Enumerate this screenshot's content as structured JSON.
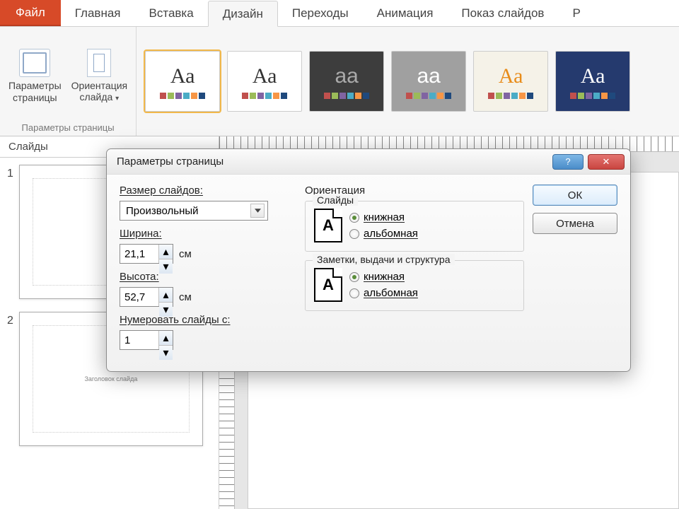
{
  "tabs": {
    "file": "Файл",
    "home": "Главная",
    "insert": "Вставка",
    "design": "Дизайн",
    "transitions": "Переходы",
    "animations": "Анимация",
    "slideshow": "Показ слайдов",
    "extra": "Р"
  },
  "ribbon": {
    "pagesetup_caption1": "Параметры",
    "pagesetup_caption2": "страницы",
    "orientation_caption1": "Ориентация",
    "orientation_caption2": "слайда",
    "dropdown_marker": "▾",
    "group_label": "Параметры страницы",
    "themes": [
      "Аа",
      "Аа",
      "Aa",
      "Aa",
      "Аа",
      "Аа"
    ]
  },
  "slides": {
    "tab_label": "Слайды",
    "items": [
      {
        "num": "1",
        "caption": ""
      },
      {
        "num": "2",
        "caption": "Заголовок слайда"
      }
    ]
  },
  "dialog": {
    "title": "Параметры страницы",
    "help_icon": "?",
    "close_icon": "✕",
    "size_label": "Размер слайдов:",
    "size_value": "Произвольный",
    "width_label": "Ширина:",
    "width_value": "21,1",
    "unit": "см",
    "height_label": "Высота:",
    "height_value": "52,7",
    "number_label": "Нумеровать слайды с:",
    "number_value": "1",
    "orientation_label": "Ориентация",
    "fs1_legend": "Слайды",
    "fs2_legend": "Заметки, выдачи и структура",
    "portrait_label": "книжная",
    "landscape_label": "альбомная",
    "icon_letter": "A",
    "ok": "ОК",
    "cancel": "Отмена"
  },
  "theme_colors": {
    "set": [
      "#c0504d",
      "#9bbb59",
      "#8064a2",
      "#4bacc6",
      "#f79646",
      "#1f497d"
    ]
  }
}
